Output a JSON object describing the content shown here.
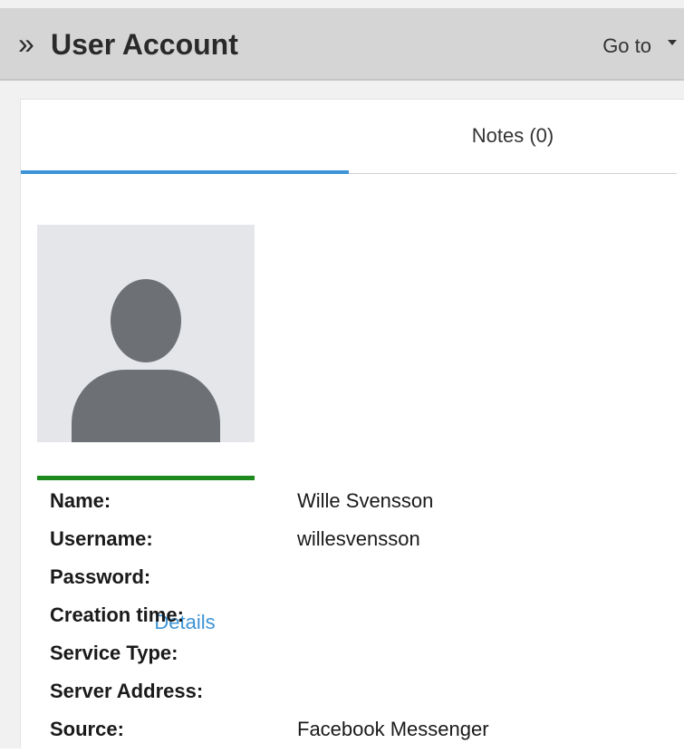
{
  "header": {
    "title": "User Account",
    "goto_label": "Go to"
  },
  "tabs": [
    {
      "label": "Details",
      "active": true
    },
    {
      "label": "Notes (0)",
      "active": false
    }
  ],
  "colors": {
    "accent": "#3d93d5",
    "status_bar": "#1e8a1e",
    "header_bg": "#d5d5d5"
  },
  "avatar": {
    "icon": "user-placeholder-icon"
  },
  "details": [
    {
      "label": "Name:",
      "value": "Wille Svensson"
    },
    {
      "label": "Username:",
      "value": "willesvensson"
    },
    {
      "label": "Password:",
      "value": ""
    },
    {
      "label": "Creation time:",
      "value": ""
    },
    {
      "label": "Service Type:",
      "value": ""
    },
    {
      "label": "Server Address:",
      "value": ""
    },
    {
      "label": "Source:",
      "value": "Facebook Messenger"
    }
  ]
}
